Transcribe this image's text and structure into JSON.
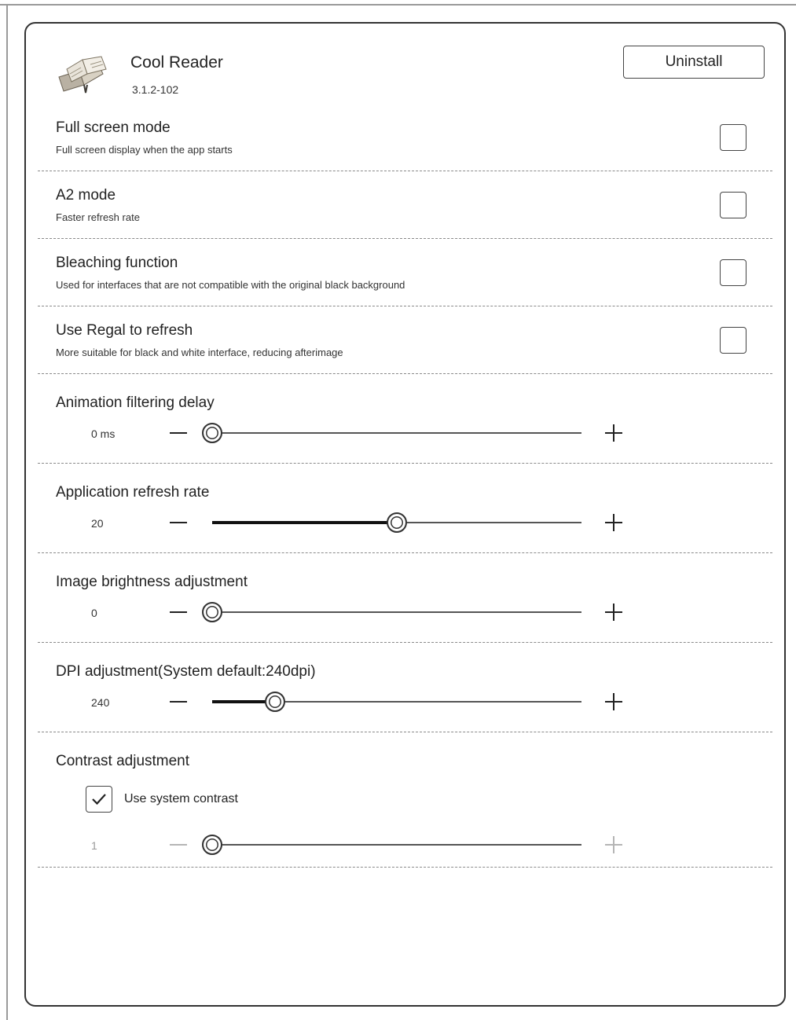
{
  "app": {
    "name": "Cool Reader",
    "version": "3.1.2-102",
    "uninstall_label": "Uninstall",
    "icon": "book-icon"
  },
  "toggles": [
    {
      "title": "Full screen mode",
      "desc": "Full screen display when the app starts",
      "checked": false
    },
    {
      "title": "A2 mode",
      "desc": "Faster refresh rate",
      "checked": false
    },
    {
      "title": "Bleaching function",
      "desc": "Used for interfaces that are not compatible with the original black background",
      "checked": false
    },
    {
      "title": "Use Regal to refresh",
      "desc": "More suitable for black and white interface, reducing afterimage",
      "checked": false
    }
  ],
  "sliders": [
    {
      "title": "Animation filtering delay",
      "value": "0 ms",
      "level": 0.0
    },
    {
      "title": "Application refresh rate",
      "value": "20",
      "level": 0.5
    },
    {
      "title": "Image brightness adjustment",
      "value": "0",
      "level": 0.0
    },
    {
      "title": "DPI adjustment(System default:240dpi)",
      "value": "240",
      "level": 0.17
    }
  ],
  "contrast": {
    "title": "Contrast adjustment",
    "use_system_label": "Use system contrast",
    "use_system_checked": true,
    "value": "1",
    "level": 0.0,
    "enabled": false
  },
  "colors": {
    "border": "#333333",
    "divider": "#8a8a8a",
    "disabled": "#b5b5b5"
  }
}
